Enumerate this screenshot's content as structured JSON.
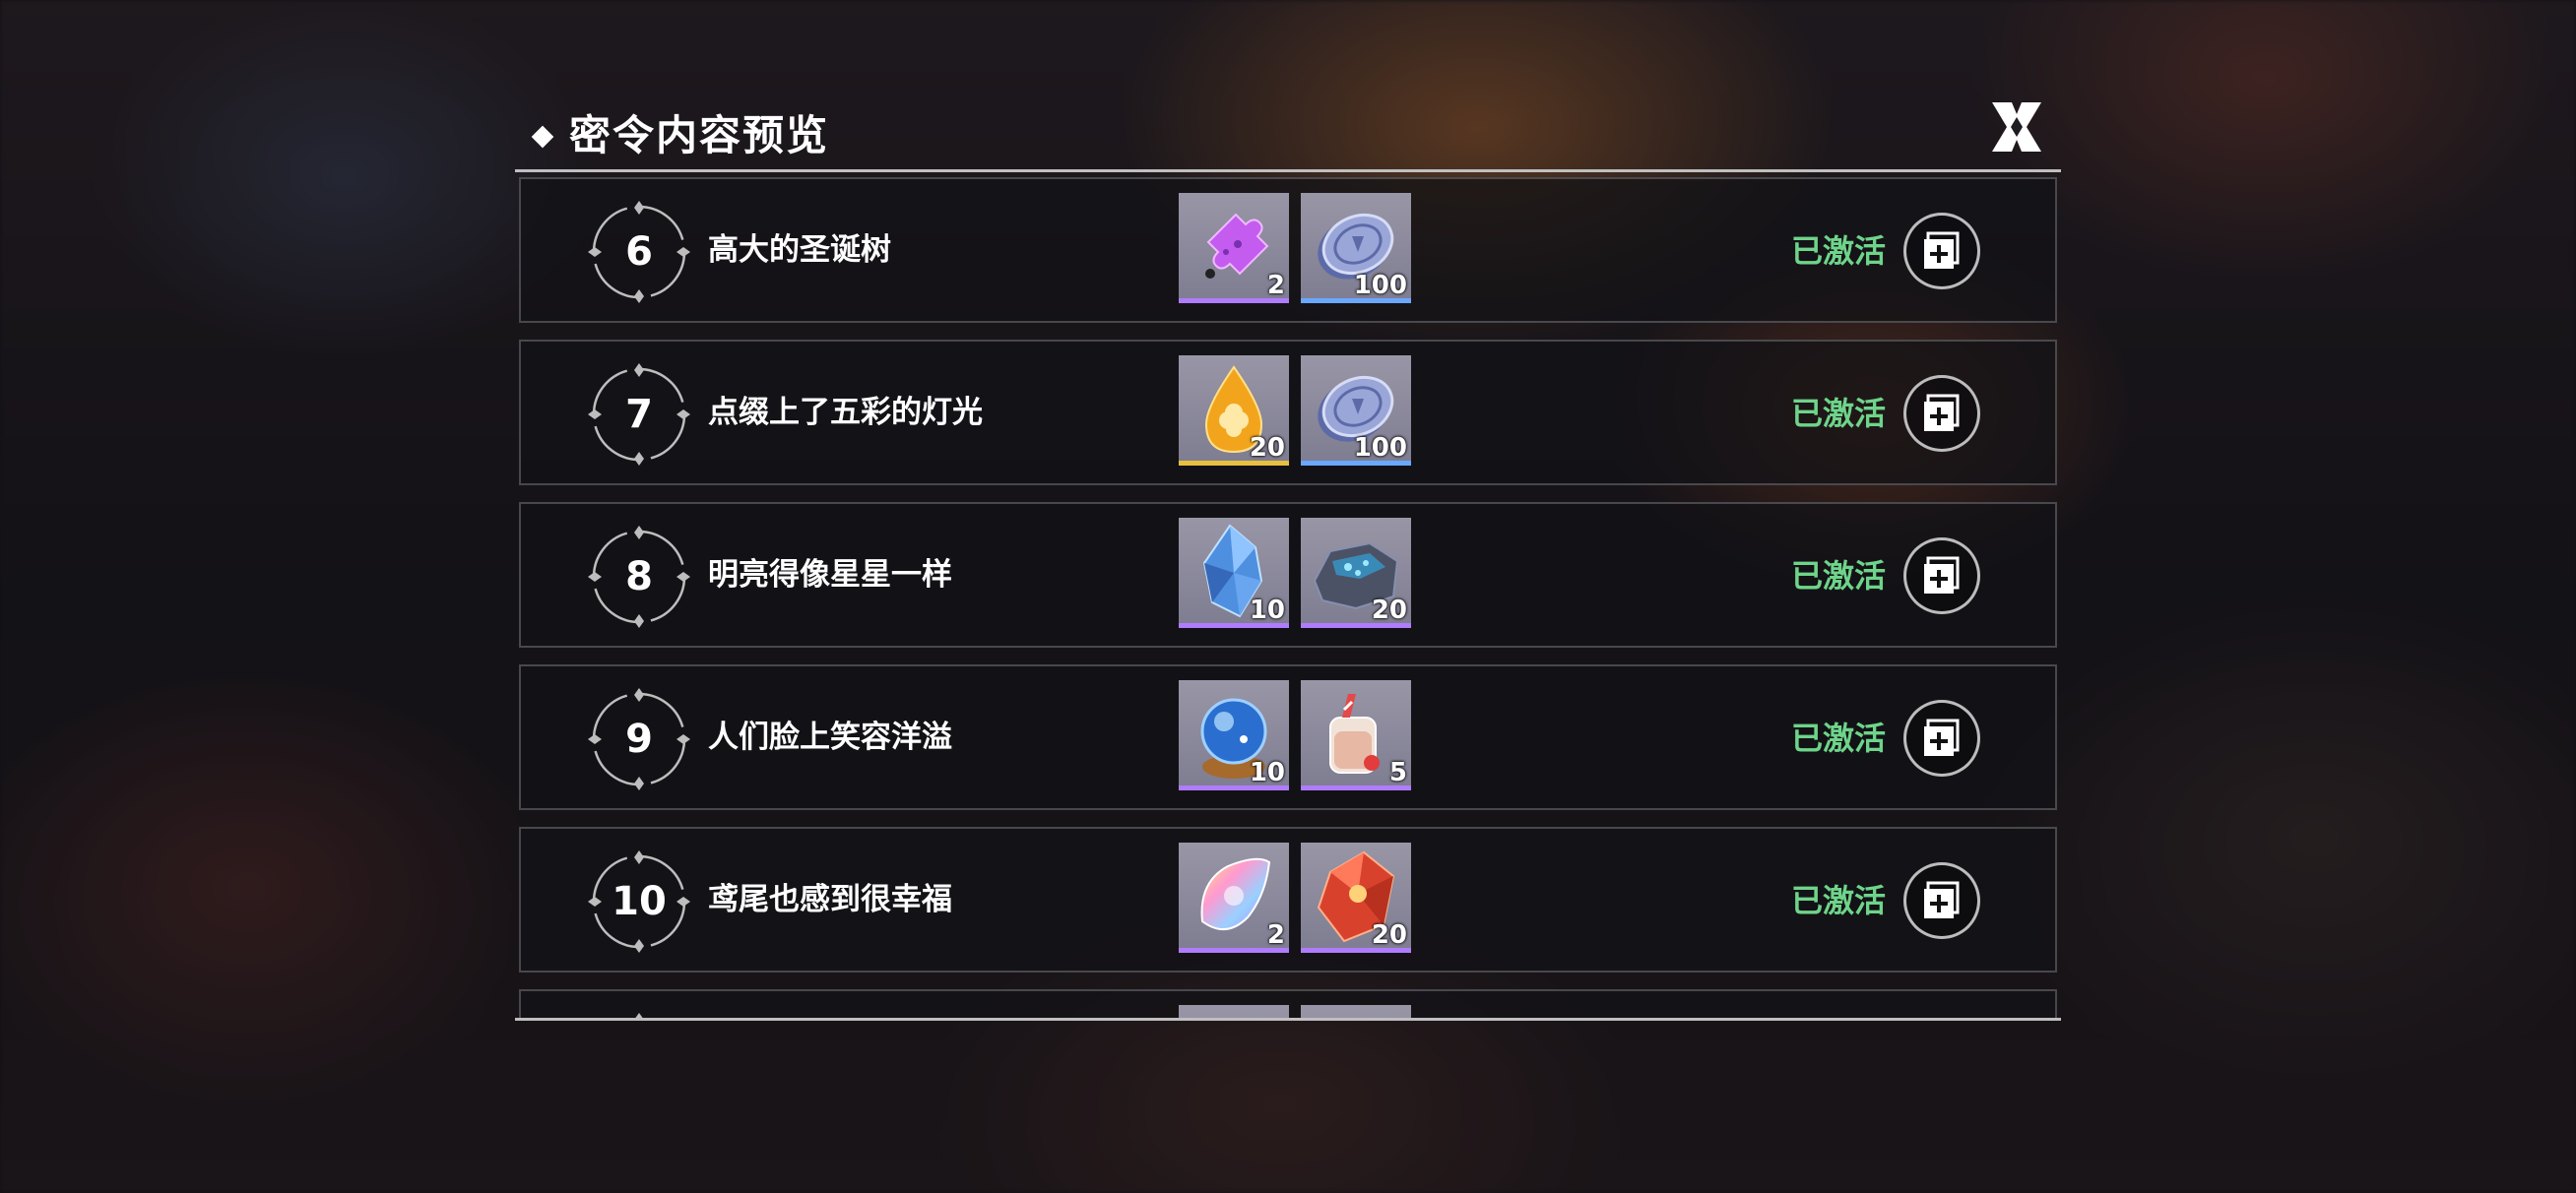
{
  "header": {
    "title": "密令内容预览",
    "close_icon": "close-x-icon"
  },
  "status_color": "#6ed48a",
  "tiers": [
    {
      "level": "6",
      "title": "高大的圣诞树",
      "status": "已激活",
      "rewards": [
        {
          "icon": "purple-puzzle-piece-icon",
          "qty": "2",
          "color": "#b07cff"
        },
        {
          "icon": "silver-coin-icon",
          "qty": "100",
          "color": "#6aa8ff"
        }
      ]
    },
    {
      "level": "7",
      "title": "点缀上了五彩的灯光",
      "status": "已激活",
      "rewards": [
        {
          "icon": "golden-clover-drop-icon",
          "qty": "20",
          "color": "#e8c040"
        },
        {
          "icon": "silver-coin-icon",
          "qty": "100",
          "color": "#6aa8ff"
        }
      ]
    },
    {
      "level": "8",
      "title": "明亮得像星星一样",
      "status": "已激活",
      "rewards": [
        {
          "icon": "blue-crystal-icon",
          "qty": "10",
          "color": "#b07cff"
        },
        {
          "icon": "ore-rock-icon",
          "qty": "20",
          "color": "#b07cff"
        }
      ]
    },
    {
      "level": "9",
      "title": "人们脸上笑容洋溢",
      "status": "已激活",
      "rewards": [
        {
          "icon": "crystal-ball-icon",
          "qty": "10",
          "color": "#b07cff"
        },
        {
          "icon": "candy-jar-icon",
          "qty": "5",
          "color": "#b07cff"
        }
      ]
    },
    {
      "level": "10",
      "title": "鸢尾也感到很幸福",
      "status": "已激活",
      "rewards": [
        {
          "icon": "rainbow-drop-icon",
          "qty": "2",
          "color": "#b07cff"
        },
        {
          "icon": "red-gem-icon",
          "qty": "20",
          "color": "#b07cff"
        }
      ]
    }
  ]
}
